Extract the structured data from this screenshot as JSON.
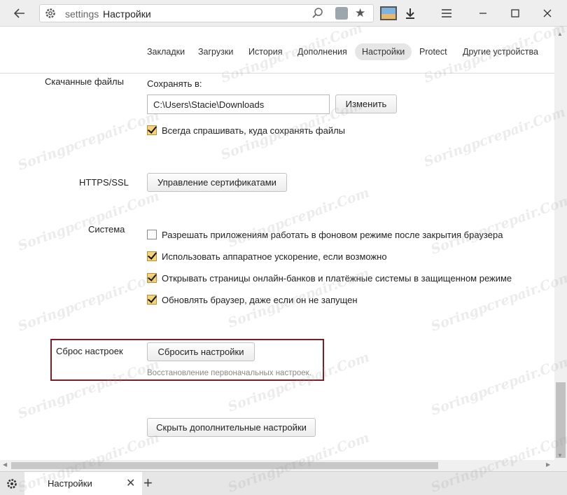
{
  "browser": {
    "address_scheme": "settings",
    "address_title": "Настройки"
  },
  "nav": {
    "tabs": [
      "Закладки",
      "Загрузки",
      "История",
      "Дополнения",
      "Настройки",
      "Protect",
      "Другие устройства"
    ],
    "active": "Настройки"
  },
  "downloads": {
    "section_label": "Скачанные файлы",
    "save_to_label": "Сохранять в:",
    "path_value": "C:\\Users\\Stacie\\Downloads",
    "change_button": "Изменить",
    "always_ask": {
      "label": "Всегда спрашивать, куда сохранять файлы",
      "checked": true
    }
  },
  "https": {
    "section_label": "HTTPS/SSL",
    "manage_certs_button": "Управление сертификатами"
  },
  "system": {
    "section_label": "Система",
    "options": [
      {
        "label": "Разрешать приложениям работать в фоновом режиме после закрытия браузера",
        "checked": false
      },
      {
        "label": "Использовать аппаратное ускорение, если возможно",
        "checked": true
      },
      {
        "label": "Открывать страницы онлайн-банков и платёжные системы в защищенном режиме",
        "checked": true
      },
      {
        "label": "Обновлять браузер, даже если он не запущен",
        "checked": true
      }
    ]
  },
  "reset": {
    "section_label": "Сброс настроек",
    "reset_button": "Сбросить настройки",
    "hint": "Восстановление первоначальных настроек."
  },
  "hide_advanced_button": "Скрыть дополнительные настройки",
  "bottom_tab": {
    "title": "Настройки"
  },
  "watermark": "Soringpcrepair.Com",
  "colors": {
    "highlight_border": "#7a1f2a",
    "checkbox_fill": "#f5d37a"
  }
}
